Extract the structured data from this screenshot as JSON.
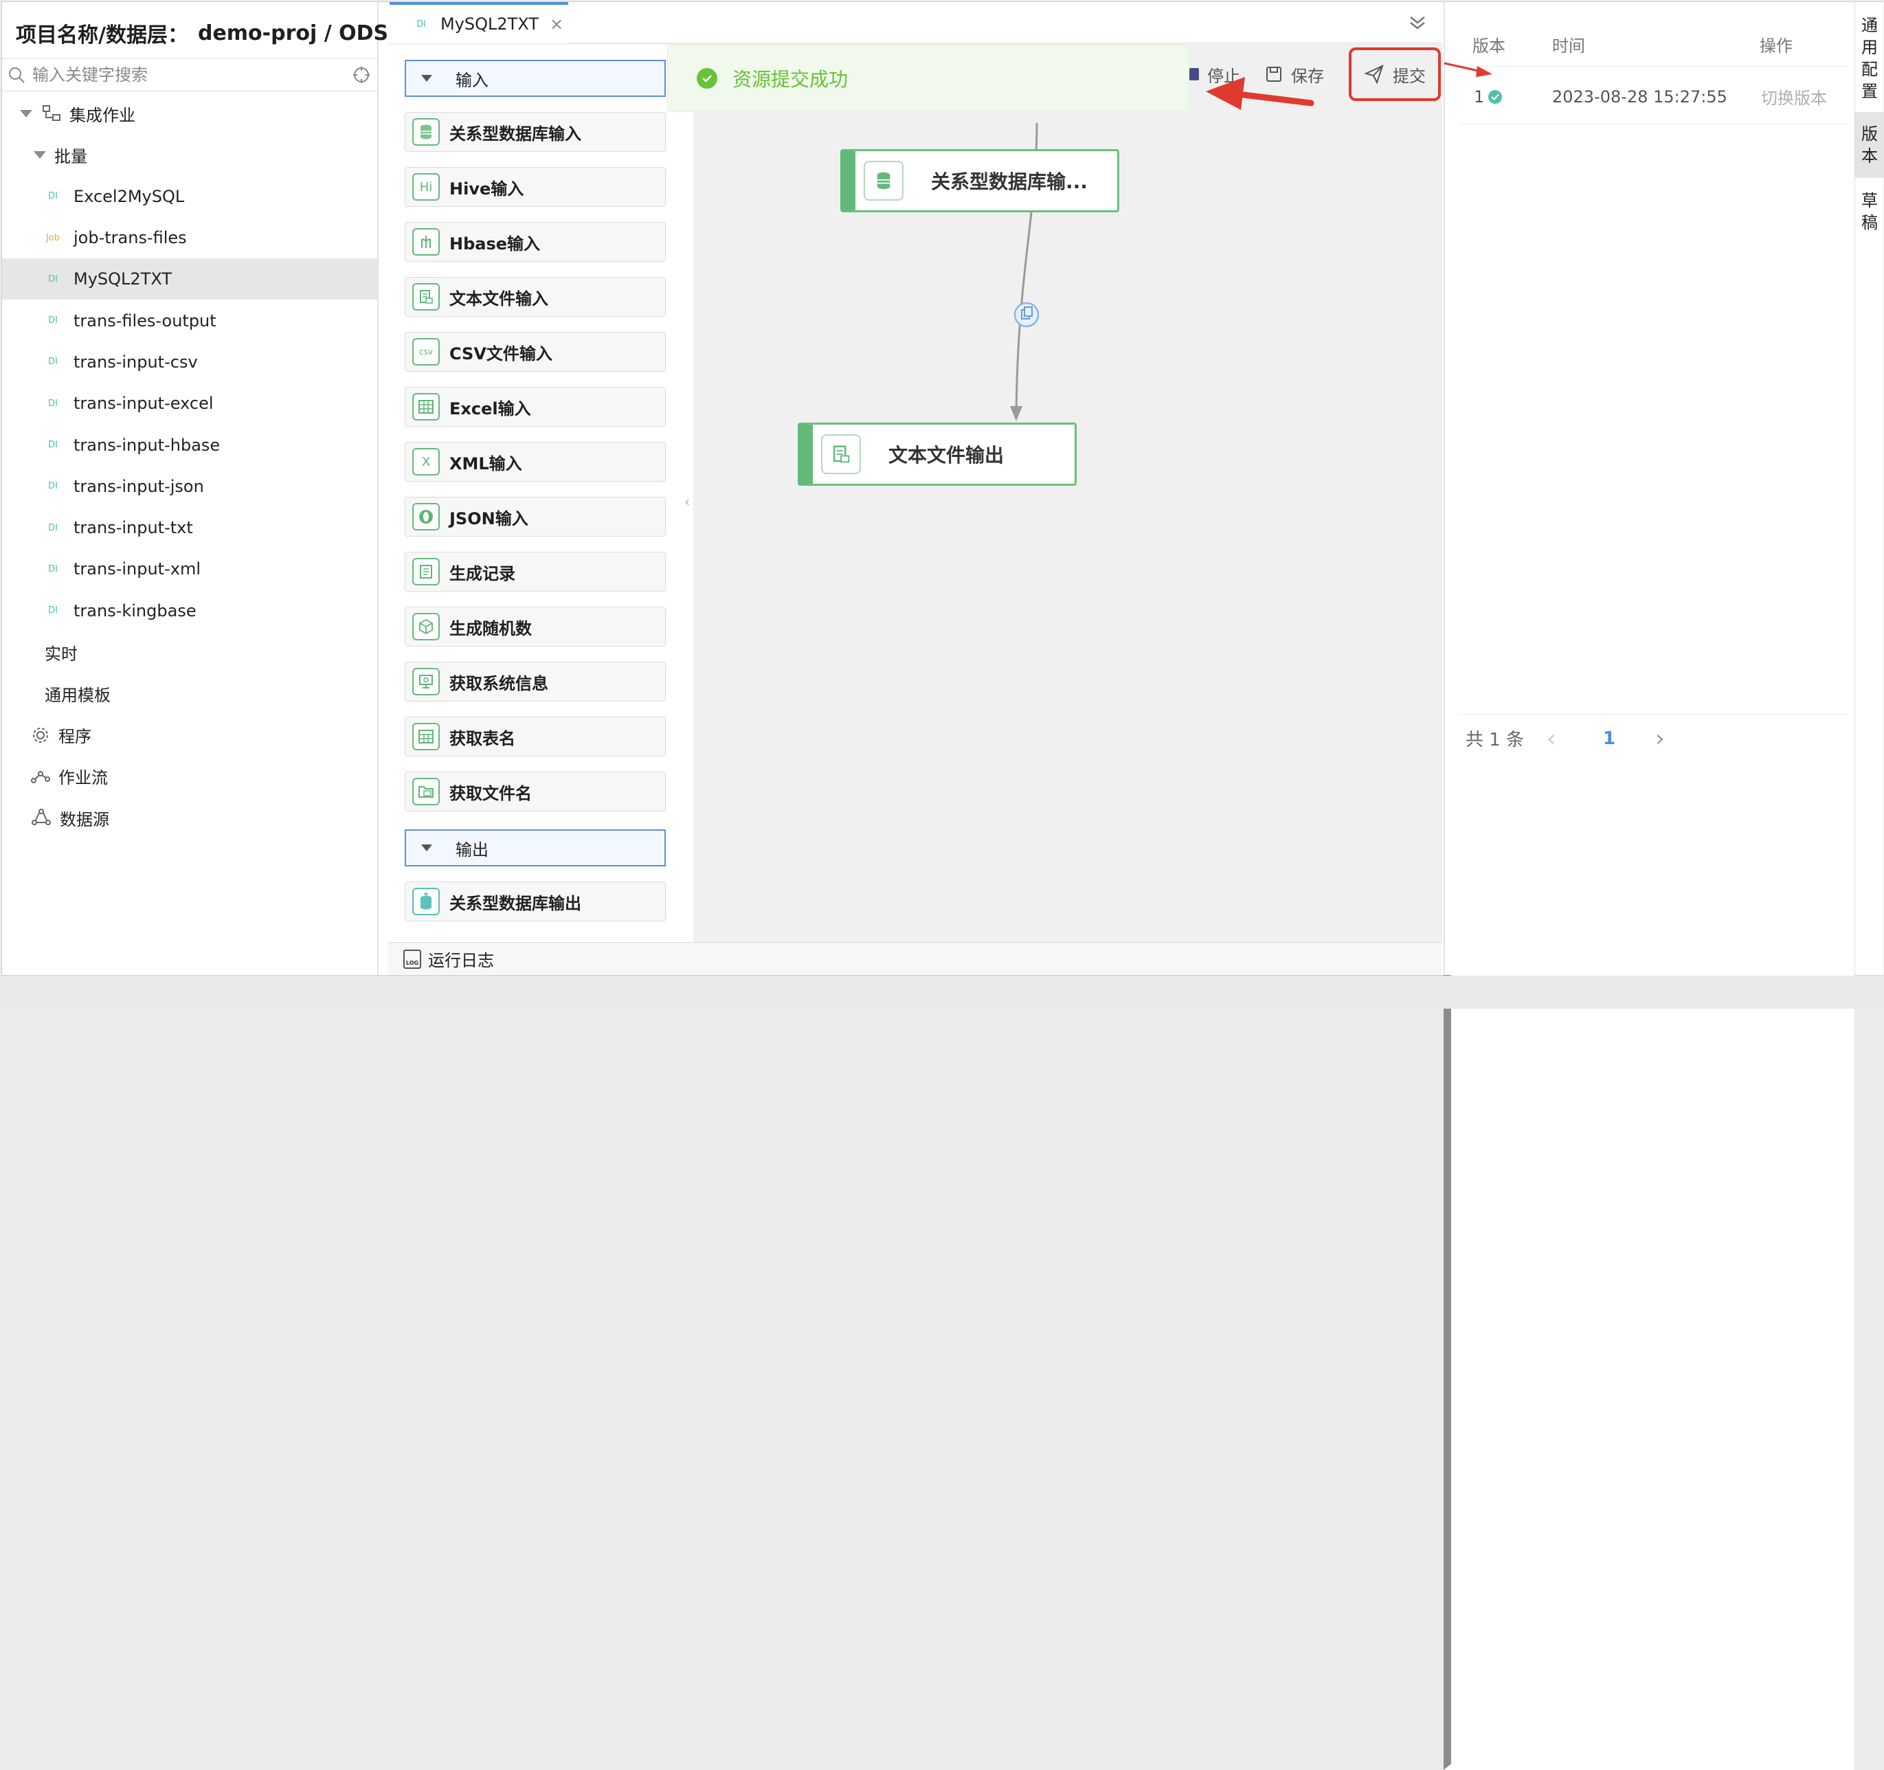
{
  "project": {
    "label": "项目名称/数据层：",
    "value": "demo-proj / ODS"
  },
  "search": {
    "placeholder": "输入关键字搜索"
  },
  "tree": {
    "integration": "集成作业",
    "batch": "批量",
    "batch_items": [
      {
        "badge": "DI",
        "label": "Excel2MySQL"
      },
      {
        "badge": "Job",
        "label": "job-trans-files"
      },
      {
        "badge": "DI",
        "label": "MySQL2TXT"
      },
      {
        "badge": "DI",
        "label": "trans-files-output"
      },
      {
        "badge": "DI",
        "label": "trans-input-csv"
      },
      {
        "badge": "DI",
        "label": "trans-input-excel"
      },
      {
        "badge": "DI",
        "label": "trans-input-hbase"
      },
      {
        "badge": "DI",
        "label": "trans-input-json"
      },
      {
        "badge": "DI",
        "label": "trans-input-txt"
      },
      {
        "badge": "DI",
        "label": "trans-input-xml"
      },
      {
        "badge": "DI",
        "label": "trans-kingbase"
      }
    ],
    "realtime": "实时",
    "template": "通用模板",
    "program": "程序",
    "workflow": "作业流",
    "datasource": "数据源"
  },
  "tab": {
    "badge": "DI",
    "label": "MySQL2TXT",
    "close": "×"
  },
  "palette": {
    "input_category": "输入",
    "inputs": [
      "关系型数据库输入",
      "Hive输入",
      "Hbase输入",
      "文本文件输入",
      "CSV文件输入",
      "Excel输入",
      "XML输入",
      "JSON输入",
      "生成记录",
      "生成随机数",
      "获取系统信息",
      "获取表名",
      "获取文件名"
    ],
    "input_icons": [
      "database-icon",
      "hive-icon",
      "hbase-icon",
      "text-file-icon",
      "csv-file-icon",
      "excel-icon",
      "xml-icon",
      "json-icon",
      "records-icon",
      "random-icon",
      "system-info-icon",
      "table-name-icon",
      "file-name-icon"
    ],
    "icon_glyphs": {
      "hive": "Hi",
      "csv": "csv",
      "xml": "X"
    },
    "output_category": "输出",
    "outputs": [
      "关系型数据库输出"
    ]
  },
  "toast": {
    "message": "资源提交成功"
  },
  "toolbar": {
    "stop": "停止",
    "save": "保存",
    "submit": "提交"
  },
  "canvas": {
    "nodes": [
      {
        "label": "关系型数据库输...",
        "icon": "database-icon"
      },
      {
        "label": "文本文件输出",
        "icon": "text-file-output-icon"
      }
    ]
  },
  "log": {
    "label": "运行日志",
    "icon_text": "LOG"
  },
  "versions": {
    "headers": {
      "version": "版本",
      "time": "时间",
      "action": "操作"
    },
    "rows": [
      {
        "version": "1",
        "time": "2023-08-28 15:27:55",
        "action": "切换版本"
      }
    ],
    "total": "共 1 条",
    "page": "1",
    "prev": "‹",
    "next": "›"
  },
  "side_tabs": [
    {
      "label": "通用配置",
      "chars": [
        "通",
        "用",
        "配",
        "置"
      ]
    },
    {
      "label": "版本",
      "chars": [
        "版",
        "本"
      ]
    },
    {
      "label": "草稿",
      "chars": [
        "草",
        "稿"
      ]
    }
  ],
  "colors": {
    "accent": "#4d8fe6",
    "success": "#67c23a",
    "node_green": "#62b97a",
    "annotation_red": "#e03a2f"
  }
}
